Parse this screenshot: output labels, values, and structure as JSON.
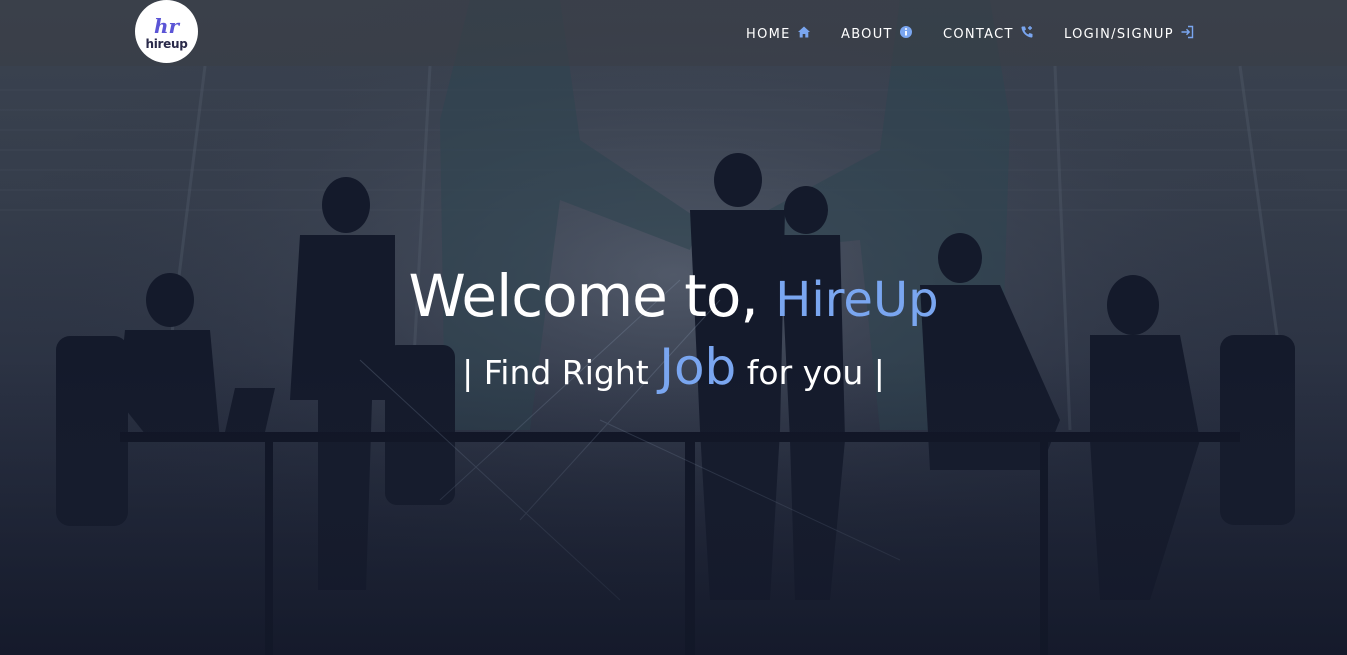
{
  "logo": {
    "text": "hireup",
    "mark": "hr",
    "alt_icon": "hireup-logo"
  },
  "nav": {
    "items": [
      {
        "label": "HOME",
        "icon": "home-icon"
      },
      {
        "label": "ABOUT",
        "icon": "info-icon"
      },
      {
        "label": "CONTACT",
        "icon": "phone-plus-icon"
      },
      {
        "label": "LOGIN/SIGNUP",
        "icon": "login-icon"
      }
    ]
  },
  "hero": {
    "welcome_prefix": "Welcome to,",
    "brand": "HireUp",
    "tagline_prefix": "| Find Right",
    "tagline_highlight": "Job",
    "tagline_suffix": "for you |"
  },
  "colors": {
    "accent": "#7aa6f0",
    "text": "#ffffff",
    "navbar": "#3a3e46"
  }
}
